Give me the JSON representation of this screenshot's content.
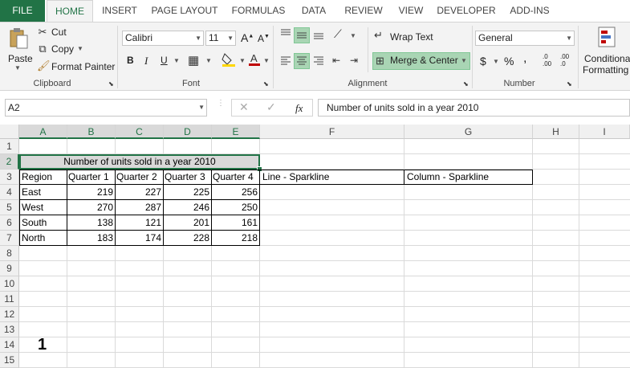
{
  "tabs": [
    "FILE",
    "HOME",
    "INSERT",
    "PAGE LAYOUT",
    "FORMULAS",
    "DATA",
    "REVIEW",
    "VIEW",
    "DEVELOPER",
    "ADD-INS"
  ],
  "ribbon": {
    "clipboard": {
      "paste": "Paste",
      "cut": "Cut",
      "copy": "Copy",
      "format_painter": "Format Painter",
      "label": "Clipboard"
    },
    "font": {
      "family": "Calibri",
      "size": "11",
      "bold": "B",
      "italic": "I",
      "underline": "U",
      "grow": "A",
      "shrink": "A",
      "label": "Font"
    },
    "alignment": {
      "wrap_text": "Wrap Text",
      "merge_center": "Merge & Center",
      "label": "Alignment"
    },
    "number": {
      "format": "General",
      "currency": "$",
      "percent": "%",
      "comma": ",",
      "inc_decimal": ".0 .00",
      "dec_decimal": ".00 .0",
      "label": "Number"
    },
    "styles": {
      "conditional": "Conditional",
      "formatting": "Formatting"
    }
  },
  "formula_bar": {
    "name_box": "A2",
    "fx": "fx",
    "content": "Number of units sold in a year 2010"
  },
  "columns": [
    "A",
    "B",
    "C",
    "D",
    "E",
    "F",
    "G",
    "H",
    "I"
  ],
  "rows": [
    "1",
    "2",
    "3",
    "4",
    "5",
    "6",
    "7",
    "8",
    "9",
    "10",
    "11",
    "12",
    "13",
    "14",
    "15"
  ],
  "sheet": {
    "title": "Number of units sold in a year 2010",
    "headers": [
      "Region",
      "Quarter 1",
      "Quarter 2",
      "Quarter 3",
      "Quarter 4"
    ],
    "line_sparkline": "Line - Sparkline",
    "column_sparkline": "Column - Sparkline",
    "data": [
      [
        "East",
        "219",
        "227",
        "225",
        "256"
      ],
      [
        "West",
        "270",
        "287",
        "246",
        "250"
      ],
      [
        "South",
        "138",
        "121",
        "201",
        "161"
      ],
      [
        "North",
        "183",
        "174",
        "228",
        "218"
      ]
    ],
    "annotation": "1"
  },
  "colors": {
    "accent": "#217346",
    "highlight": "#a9d5b4",
    "font_red": "#c00000"
  }
}
